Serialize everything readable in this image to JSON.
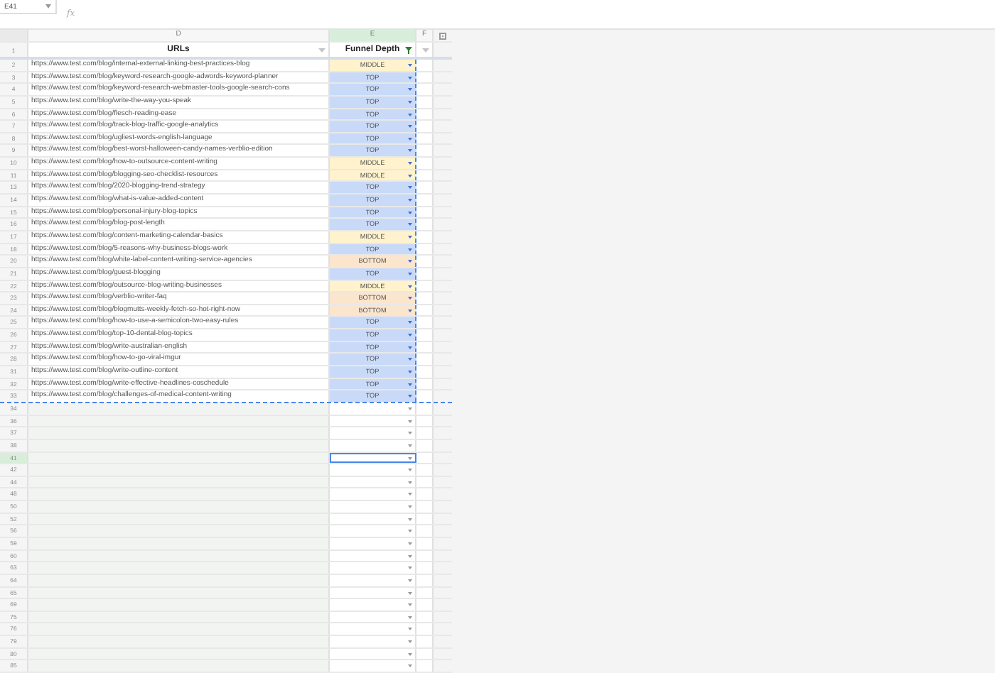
{
  "name_box": {
    "value": "E41"
  },
  "formula_bar": {
    "fx": "fx"
  },
  "columns": [
    {
      "letter": "D",
      "selected": false
    },
    {
      "letter": "E",
      "selected": true
    },
    {
      "letter": "F",
      "selected": false
    }
  ],
  "header_row": {
    "row": "1",
    "cells": [
      {
        "text": "URLs",
        "filtered": false
      },
      {
        "text": "Funnel Depth",
        "filtered": true
      }
    ]
  },
  "rows": [
    {
      "row": "2",
      "url": "https://www.test.com/blog/internal-external-linking-best-practices-blog",
      "depth": "MIDDLE",
      "kind": "middle",
      "copied": true,
      "selected": false
    },
    {
      "row": "3",
      "url": "https://www.test.com/blog/keyword-research-google-adwords-keyword-planner",
      "depth": "TOP",
      "kind": "top",
      "copied": true,
      "selected": false
    },
    {
      "row": "4",
      "url": "https://www.test.com/blog/keyword-research-webmaster-tools-google-search-cons",
      "depth": "TOP",
      "kind": "top",
      "copied": true,
      "selected": false
    },
    {
      "row": "5",
      "url": "https://www.test.com/blog/write-the-way-you-speak",
      "depth": "TOP",
      "kind": "top",
      "copied": true,
      "selected": false
    },
    {
      "row": "6",
      "url": "https://www.test.com/blog/flesch-reading-ease",
      "depth": "TOP",
      "kind": "top",
      "copied": true,
      "selected": false
    },
    {
      "row": "7",
      "url": "https://www.test.com/blog/track-blog-traffic-google-analytics",
      "depth": "TOP",
      "kind": "top",
      "copied": true,
      "selected": false
    },
    {
      "row": "8",
      "url": "https://www.test.com/blog/ugliest-words-english-language",
      "depth": "TOP",
      "kind": "top",
      "copied": true,
      "selected": false
    },
    {
      "row": "9",
      "url": "https://www.test.com/blog/best-worst-halloween-candy-names-verblio-edition",
      "depth": "TOP",
      "kind": "top",
      "copied": true,
      "selected": false
    },
    {
      "row": "10",
      "url": "https://www.test.com/blog/how-to-outsource-content-writing",
      "depth": "MIDDLE",
      "kind": "middle",
      "copied": true,
      "selected": false
    },
    {
      "row": "11",
      "url": "https://www.test.com/blog/blogging-seo-checklist-resources",
      "depth": "MIDDLE",
      "kind": "middle",
      "copied": true,
      "selected": false
    },
    {
      "row": "13",
      "url": "https://www.test.com/blog/2020-blogging-trend-strategy",
      "depth": "TOP",
      "kind": "top",
      "copied": true,
      "selected": false
    },
    {
      "row": "14",
      "url": "https://www.test.com/blog/what-is-value-added-content",
      "depth": "TOP",
      "kind": "top",
      "copied": true,
      "selected": false
    },
    {
      "row": "15",
      "url": "https://www.test.com/blog/personal-injury-blog-topics",
      "depth": "TOP",
      "kind": "top",
      "copied": true,
      "selected": false
    },
    {
      "row": "16",
      "url": "https://www.test.com/blog/blog-post-length",
      "depth": "TOP",
      "kind": "top",
      "copied": true,
      "selected": false
    },
    {
      "row": "17",
      "url": "https://www.test.com/blog/content-marketing-calendar-basics",
      "depth": "MIDDLE",
      "kind": "middle",
      "copied": true,
      "selected": false
    },
    {
      "row": "18",
      "url": "https://www.test.com/blog/5-reasons-why-business-blogs-work",
      "depth": "TOP",
      "kind": "top",
      "copied": true,
      "selected": false
    },
    {
      "row": "20",
      "url": "https://www.test.com/blog/white-label-content-writing-service-agencies",
      "depth": "BOTTOM",
      "kind": "bottom",
      "copied": true,
      "selected": false
    },
    {
      "row": "21",
      "url": "https://www.test.com/blog/guest-blogging",
      "depth": "TOP",
      "kind": "top",
      "copied": true,
      "selected": false
    },
    {
      "row": "22",
      "url": "https://www.test.com/blog/outsource-blog-writing-businesses",
      "depth": "MIDDLE",
      "kind": "middle",
      "copied": true,
      "selected": false
    },
    {
      "row": "23",
      "url": "https://www.test.com/blog/verblio-writer-faq",
      "depth": "BOTTOM",
      "kind": "bottom",
      "copied": true,
      "selected": false
    },
    {
      "row": "24",
      "url": "https://www.test.com/blog/blogmutts-weekly-fetch-so-hot-right-now",
      "depth": "BOTTOM",
      "kind": "bottom",
      "copied": true,
      "selected": false
    },
    {
      "row": "25",
      "url": "https://www.test.com/blog/how-to-use-a-semicolon-two-easy-rules",
      "depth": "TOP",
      "kind": "top",
      "copied": true,
      "selected": false
    },
    {
      "row": "26",
      "url": "https://www.test.com/blog/top-10-dental-blog-topics",
      "depth": "TOP",
      "kind": "top",
      "copied": true,
      "selected": false
    },
    {
      "row": "27",
      "url": "https://www.test.com/blog/write-australian-english",
      "depth": "TOP",
      "kind": "top",
      "copied": true,
      "selected": false
    },
    {
      "row": "28",
      "url": "https://www.test.com/blog/how-to-go-viral-imgur",
      "depth": "TOP",
      "kind": "top",
      "copied": true,
      "selected": false
    },
    {
      "row": "31",
      "url": "https://www.test.com/blog/write-outline-content",
      "depth": "TOP",
      "kind": "top",
      "copied": true,
      "selected": false
    },
    {
      "row": "32",
      "url": "https://www.test.com/blog/write-effective-headlines-coschedule",
      "depth": "TOP",
      "kind": "top",
      "copied": true,
      "selected": false
    },
    {
      "row": "33",
      "url": "https://www.test.com/blog/challenges-of-medical-content-writing",
      "depth": "TOP",
      "kind": "top",
      "copied": true,
      "selected": false
    },
    {
      "row": "34",
      "kind": "empty",
      "copied": false,
      "selected": false
    },
    {
      "row": "36",
      "kind": "empty",
      "copied": false,
      "selected": false
    },
    {
      "row": "37",
      "kind": "empty",
      "copied": false,
      "selected": false
    },
    {
      "row": "38",
      "kind": "empty",
      "copied": false,
      "selected": false
    },
    {
      "row": "41",
      "kind": "empty",
      "copied": false,
      "selected": true
    },
    {
      "row": "42",
      "kind": "empty",
      "copied": false,
      "selected": false
    },
    {
      "row": "44",
      "kind": "empty",
      "copied": false,
      "selected": false
    },
    {
      "row": "48",
      "kind": "empty",
      "copied": false,
      "selected": false
    },
    {
      "row": "50",
      "kind": "empty",
      "copied": false,
      "selected": false
    },
    {
      "row": "52",
      "kind": "empty",
      "copied": false,
      "selected": false
    },
    {
      "row": "56",
      "kind": "empty",
      "copied": false,
      "selected": false
    },
    {
      "row": "59",
      "kind": "empty",
      "copied": false,
      "selected": false
    },
    {
      "row": "60",
      "kind": "empty",
      "copied": false,
      "selected": false
    },
    {
      "row": "63",
      "kind": "empty",
      "copied": false,
      "selected": false
    },
    {
      "row": "64",
      "kind": "empty",
      "copied": false,
      "selected": false
    },
    {
      "row": "65",
      "kind": "empty",
      "copied": false,
      "selected": false
    },
    {
      "row": "69",
      "kind": "empty",
      "copied": false,
      "selected": false
    },
    {
      "row": "75",
      "kind": "empty",
      "copied": false,
      "selected": false
    },
    {
      "row": "76",
      "kind": "empty",
      "copied": false,
      "selected": false
    },
    {
      "row": "79",
      "kind": "empty",
      "copied": false,
      "selected": false
    },
    {
      "row": "80",
      "kind": "empty",
      "copied": false,
      "selected": false
    },
    {
      "row": "85",
      "kind": "empty",
      "copied": false,
      "selected": false
    }
  ]
}
